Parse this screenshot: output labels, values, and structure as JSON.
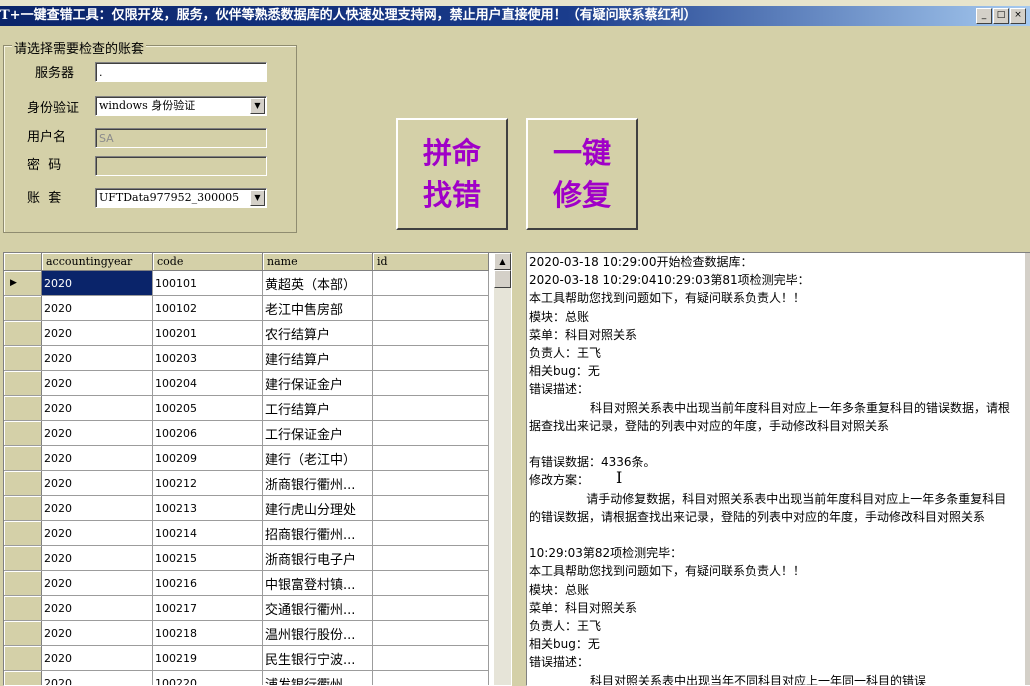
{
  "window": {
    "title": "T+一键查错工具：仅限开发，服务，伙伴等熟悉数据库的人快速处理支持网，禁止用户直接使用！（有疑问联系蔡红利）",
    "controls": {
      "minimize": "_",
      "maximize": "□",
      "close": "×"
    }
  },
  "form": {
    "group_title": "请选择需要检查的账套",
    "server_label": "服务器",
    "server_value": ".",
    "auth_label": "身份验证",
    "auth_value": "windows 身份验证",
    "user_label": "用户名",
    "user_value": "SA",
    "password_label": "密  码",
    "password_value": "",
    "account_label": "账  套",
    "account_value": "UFTData977952_300005"
  },
  "buttons": {
    "find_errors": "拼命找错",
    "one_click_fix": "一键修复"
  },
  "grid": {
    "columns": [
      "accountingyear",
      "code",
      "name",
      "id"
    ],
    "rows": [
      [
        "2020",
        "100101",
        "黄超英（本部）",
        ""
      ],
      [
        "2020",
        "100102",
        "老江中售房部",
        ""
      ],
      [
        "2020",
        "100201",
        "农行结算户",
        ""
      ],
      [
        "2020",
        "100203",
        "建行结算户",
        ""
      ],
      [
        "2020",
        "100204",
        "建行保证金户",
        ""
      ],
      [
        "2020",
        "100205",
        "工行结算户",
        ""
      ],
      [
        "2020",
        "100206",
        "工行保证金户",
        ""
      ],
      [
        "2020",
        "100209",
        "建行（老江中）",
        ""
      ],
      [
        "2020",
        "100212",
        "浙商银行衢州...",
        ""
      ],
      [
        "2020",
        "100213",
        "建行虎山分理处",
        ""
      ],
      [
        "2020",
        "100214",
        "招商银行衢州...",
        ""
      ],
      [
        "2020",
        "100215",
        "浙商银行电子户",
        ""
      ],
      [
        "2020",
        "100216",
        "中银富登村镇...",
        ""
      ],
      [
        "2020",
        "100217",
        "交通银行衢州...",
        ""
      ],
      [
        "2020",
        "100218",
        "温州银行股份...",
        ""
      ],
      [
        "2020",
        "100219",
        "民生银行宁波...",
        ""
      ],
      [
        "2020",
        "100220",
        "浦发银行衢州...",
        ""
      ]
    ],
    "scroll_up": "▲"
  },
  "log": {
    "text": "2020-03-18 10:29:00开始检查数据库：\n2020-03-18 10:29:0410:29:03第81项检测完毕：\n本工具帮助您找到问题如下，有疑问联系负责人！！\n模块：总账\n菜单：科目对照关系\n负责人：王飞\n相关bug：无\n错误描述：\n                科目对照关系表中出现当前年度科目对应上一年多条重复科目的错误数据，请根据查找出来记录，登陆的列表中对应的年度，手动修改科目对照关系\n\n有错误数据：4336条。\n修改方案：\n               请手动修复数据，科目对照关系表中出现当前年度科目对应上一年多条重复科目的错误数据，请根据查找出来记录，登陆的列表中对应的年度，手动修改科目对照关系\n\n10:29:03第82项检测完毕：\n本工具帮助您找到问题如下，有疑问联系负责人！！\n模块：总账\n菜单：科目对照关系\n负责人：王飞\n相关bug：无\n错误描述：\n                科目对照关系表中出现当年不同科目对应上一年同一科目的错误"
  }
}
